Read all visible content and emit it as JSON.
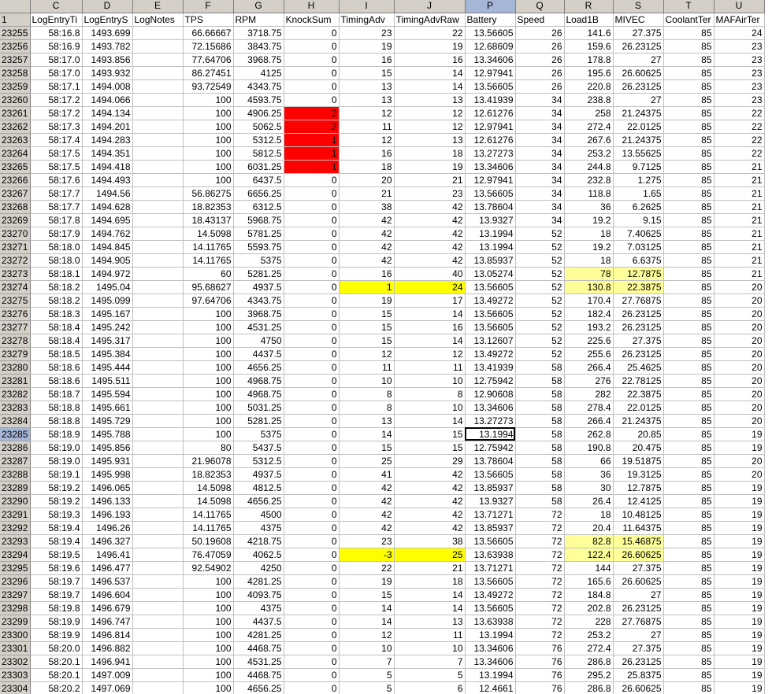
{
  "columns": [
    "C",
    "D",
    "E",
    "F",
    "G",
    "H",
    "I",
    "J",
    "P",
    "Q",
    "R",
    "S",
    "T",
    "U"
  ],
  "selected_column": "P",
  "header_row": {
    "row_label": "1",
    "cells": [
      "LogEntryTi",
      "LogEntryS",
      "LogNotes",
      "TPS",
      "RPM",
      "KnockSum",
      "TimingAdv",
      "TimingAdvRaw",
      "Battery",
      "Speed",
      "Load1B",
      "MIVEC",
      "CoolantTer",
      "MAFAirTer"
    ]
  },
  "selected_row": "23285",
  "active_cell": {
    "row": "23285",
    "col_index": 8
  },
  "rows": [
    {
      "r": "23255",
      "c": [
        "58:16.8",
        "1493.699",
        "",
        "66.66667",
        "3718.75",
        "0",
        "23",
        "22",
        "13.56605",
        "26",
        "141.6",
        "27.375",
        "85",
        "24"
      ]
    },
    {
      "r": "23256",
      "c": [
        "58:16.9",
        "1493.782",
        "",
        "72.15686",
        "3843.75",
        "0",
        "19",
        "19",
        "12.68609",
        "26",
        "159.6",
        "26.23125",
        "85",
        "23"
      ]
    },
    {
      "r": "23257",
      "c": [
        "58:17.0",
        "1493.856",
        "",
        "77.64706",
        "3968.75",
        "0",
        "16",
        "16",
        "13.34606",
        "26",
        "178.8",
        "27",
        "85",
        "23"
      ]
    },
    {
      "r": "23258",
      "c": [
        "58:17.0",
        "1493.932",
        "",
        "86.27451",
        "4125",
        "0",
        "15",
        "14",
        "12.97941",
        "26",
        "195.6",
        "26.60625",
        "85",
        "23"
      ]
    },
    {
      "r": "23259",
      "c": [
        "58:17.1",
        "1494.008",
        "",
        "93.72549",
        "4343.75",
        "0",
        "13",
        "14",
        "13.56605",
        "26",
        "220.8",
        "26.23125",
        "85",
        "23"
      ]
    },
    {
      "r": "23260",
      "c": [
        "58:17.2",
        "1494.066",
        "",
        "100",
        "4593.75",
        "0",
        "13",
        "13",
        "13.41939",
        "34",
        "238.8",
        "27",
        "85",
        "23"
      ]
    },
    {
      "r": "23261",
      "c": [
        "58:17.2",
        "1494.134",
        "",
        "100",
        "4906.25",
        "2",
        "12",
        "12",
        "12.61276",
        "34",
        "258",
        "21.24375",
        "85",
        "22"
      ]
    },
    {
      "r": "23262",
      "c": [
        "58:17.3",
        "1494.201",
        "",
        "100",
        "5062.5",
        "2",
        "11",
        "12",
        "12.97941",
        "34",
        "272.4",
        "22.0125",
        "85",
        "22"
      ]
    },
    {
      "r": "23263",
      "c": [
        "58:17.4",
        "1494.283",
        "",
        "100",
        "5312.5",
        "1",
        "12",
        "13",
        "12.61276",
        "34",
        "267.6",
        "21.24375",
        "85",
        "22"
      ]
    },
    {
      "r": "23264",
      "c": [
        "58:17.5",
        "1494.351",
        "",
        "100",
        "5812.5",
        "1",
        "16",
        "18",
        "13.27273",
        "34",
        "253.2",
        "13.55625",
        "85",
        "22"
      ]
    },
    {
      "r": "23265",
      "c": [
        "58:17.5",
        "1494.418",
        "",
        "100",
        "6031.25",
        "1",
        "18",
        "19",
        "13.34606",
        "34",
        "244.8",
        "9.7125",
        "85",
        "21"
      ]
    },
    {
      "r": "23266",
      "c": [
        "58:17.6",
        "1494.493",
        "",
        "100",
        "6437.5",
        "0",
        "20",
        "21",
        "12.97941",
        "34",
        "232.8",
        "1.275",
        "85",
        "21"
      ]
    },
    {
      "r": "23267",
      "c": [
        "58:17.7",
        "1494.56",
        "",
        "56.86275",
        "6656.25",
        "0",
        "21",
        "23",
        "13.56605",
        "34",
        "118.8",
        "1.65",
        "85",
        "21"
      ]
    },
    {
      "r": "23268",
      "c": [
        "58:17.7",
        "1494.628",
        "",
        "18.82353",
        "6312.5",
        "0",
        "38",
        "42",
        "13.78604",
        "34",
        "36",
        "6.2625",
        "85",
        "21"
      ]
    },
    {
      "r": "23269",
      "c": [
        "58:17.8",
        "1494.695",
        "",
        "18.43137",
        "5968.75",
        "0",
        "42",
        "42",
        "13.9327",
        "34",
        "19.2",
        "9.15",
        "85",
        "21"
      ]
    },
    {
      "r": "23270",
      "c": [
        "58:17.9",
        "1494.762",
        "",
        "14.5098",
        "5781.25",
        "0",
        "42",
        "42",
        "13.1994",
        "52",
        "18",
        "7.40625",
        "85",
        "21"
      ]
    },
    {
      "r": "23271",
      "c": [
        "58:18.0",
        "1494.845",
        "",
        "14.11765",
        "5593.75",
        "0",
        "42",
        "42",
        "13.1994",
        "52",
        "19.2",
        "7.03125",
        "85",
        "21"
      ]
    },
    {
      "r": "23272",
      "c": [
        "58:18.0",
        "1494.905",
        "",
        "14.11765",
        "5375",
        "0",
        "42",
        "42",
        "13.85937",
        "52",
        "18",
        "6.6375",
        "85",
        "21"
      ]
    },
    {
      "r": "23273",
      "c": [
        "58:18.1",
        "1494.972",
        "",
        "60",
        "5281.25",
        "0",
        "16",
        "40",
        "13.05274",
        "52",
        "78",
        "12.7875",
        "85",
        "21"
      ]
    },
    {
      "r": "23274",
      "c": [
        "58:18.2",
        "1495.04",
        "",
        "95.68627",
        "4937.5",
        "0",
        "1",
        "24",
        "13.56605",
        "52",
        "130.8",
        "22.3875",
        "85",
        "20"
      ]
    },
    {
      "r": "23275",
      "c": [
        "58:18.2",
        "1495.099",
        "",
        "97.64706",
        "4343.75",
        "0",
        "19",
        "17",
        "13.49272",
        "52",
        "170.4",
        "27.76875",
        "85",
        "20"
      ]
    },
    {
      "r": "23276",
      "c": [
        "58:18.3",
        "1495.167",
        "",
        "100",
        "3968.75",
        "0",
        "15",
        "14",
        "13.56605",
        "52",
        "182.4",
        "26.23125",
        "85",
        "20"
      ]
    },
    {
      "r": "23277",
      "c": [
        "58:18.4",
        "1495.242",
        "",
        "100",
        "4531.25",
        "0",
        "15",
        "16",
        "13.56605",
        "52",
        "193.2",
        "26.23125",
        "85",
        "20"
      ]
    },
    {
      "r": "23278",
      "c": [
        "58:18.4",
        "1495.317",
        "",
        "100",
        "4750",
        "0",
        "15",
        "14",
        "13.12607",
        "52",
        "225.6",
        "27.375",
        "85",
        "20"
      ]
    },
    {
      "r": "23279",
      "c": [
        "58:18.5",
        "1495.384",
        "",
        "100",
        "4437.5",
        "0",
        "12",
        "12",
        "13.49272",
        "52",
        "255.6",
        "26.23125",
        "85",
        "20"
      ]
    },
    {
      "r": "23280",
      "c": [
        "58:18.6",
        "1495.444",
        "",
        "100",
        "4656.25",
        "0",
        "11",
        "11",
        "13.41939",
        "58",
        "266.4",
        "25.4625",
        "85",
        "20"
      ]
    },
    {
      "r": "23281",
      "c": [
        "58:18.6",
        "1495.511",
        "",
        "100",
        "4968.75",
        "0",
        "10",
        "10",
        "12.75942",
        "58",
        "276",
        "22.78125",
        "85",
        "20"
      ]
    },
    {
      "r": "23282",
      "c": [
        "58:18.7",
        "1495.594",
        "",
        "100",
        "4968.75",
        "0",
        "8",
        "8",
        "12.90608",
        "58",
        "282",
        "22.3875",
        "85",
        "20"
      ]
    },
    {
      "r": "23283",
      "c": [
        "58:18.8",
        "1495.661",
        "",
        "100",
        "5031.25",
        "0",
        "8",
        "10",
        "13.34606",
        "58",
        "278.4",
        "22.0125",
        "85",
        "20"
      ]
    },
    {
      "r": "23284",
      "c": [
        "58:18.8",
        "1495.729",
        "",
        "100",
        "5281.25",
        "0",
        "13",
        "14",
        "13.27273",
        "58",
        "266.4",
        "21.24375",
        "85",
        "20"
      ]
    },
    {
      "r": "23285",
      "c": [
        "58:18.9",
        "1495.788",
        "",
        "100",
        "5375",
        "0",
        "14",
        "15",
        "13.1994",
        "58",
        "262.8",
        "20.85",
        "85",
        "19"
      ]
    },
    {
      "r": "23286",
      "c": [
        "58:19.0",
        "1495.856",
        "",
        "80",
        "5437.5",
        "0",
        "15",
        "15",
        "12.75942",
        "58",
        "190.8",
        "20.475",
        "85",
        "19"
      ]
    },
    {
      "r": "23287",
      "c": [
        "58:19.0",
        "1495.931",
        "",
        "21.96078",
        "5312.5",
        "0",
        "25",
        "29",
        "13.78604",
        "58",
        "66",
        "19.51875",
        "85",
        "20"
      ]
    },
    {
      "r": "23288",
      "c": [
        "58:19.1",
        "1495.998",
        "",
        "18.82353",
        "4937.5",
        "0",
        "41",
        "42",
        "13.56605",
        "58",
        "36",
        "19.3125",
        "85",
        "20"
      ]
    },
    {
      "r": "23289",
      "c": [
        "58:19.2",
        "1496.065",
        "",
        "14.5098",
        "4812.5",
        "0",
        "42",
        "42",
        "13.85937",
        "58",
        "30",
        "12.7875",
        "85",
        "19"
      ]
    },
    {
      "r": "23290",
      "c": [
        "58:19.2",
        "1496.133",
        "",
        "14.5098",
        "4656.25",
        "0",
        "42",
        "42",
        "13.9327",
        "58",
        "26.4",
        "12.4125",
        "85",
        "19"
      ]
    },
    {
      "r": "23291",
      "c": [
        "58:19.3",
        "1496.193",
        "",
        "14.11765",
        "4500",
        "0",
        "42",
        "42",
        "13.71271",
        "72",
        "18",
        "10.48125",
        "85",
        "19"
      ]
    },
    {
      "r": "23292",
      "c": [
        "58:19.4",
        "1496.26",
        "",
        "14.11765",
        "4375",
        "0",
        "42",
        "42",
        "13.85937",
        "72",
        "20.4",
        "11.64375",
        "85",
        "19"
      ]
    },
    {
      "r": "23293",
      "c": [
        "58:19.4",
        "1496.327",
        "",
        "50.19608",
        "4218.75",
        "0",
        "23",
        "38",
        "13.56605",
        "72",
        "82.8",
        "15.46875",
        "85",
        "19"
      ]
    },
    {
      "r": "23294",
      "c": [
        "58:19.5",
        "1496.41",
        "",
        "76.47059",
        "4062.5",
        "0",
        "-3",
        "25",
        "13.63938",
        "72",
        "122.4",
        "26.60625",
        "85",
        "19"
      ]
    },
    {
      "r": "23295",
      "c": [
        "58:19.6",
        "1496.477",
        "",
        "92.54902",
        "4250",
        "0",
        "22",
        "21",
        "13.71271",
        "72",
        "144",
        "27.375",
        "85",
        "19"
      ]
    },
    {
      "r": "23296",
      "c": [
        "58:19.7",
        "1496.537",
        "",
        "100",
        "4281.25",
        "0",
        "19",
        "18",
        "13.56605",
        "72",
        "165.6",
        "26.60625",
        "85",
        "19"
      ]
    },
    {
      "r": "23297",
      "c": [
        "58:19.7",
        "1496.604",
        "",
        "100",
        "4093.75",
        "0",
        "15",
        "14",
        "13.49272",
        "72",
        "184.8",
        "27",
        "85",
        "19"
      ]
    },
    {
      "r": "23298",
      "c": [
        "58:19.8",
        "1496.679",
        "",
        "100",
        "4375",
        "0",
        "14",
        "14",
        "13.56605",
        "72",
        "202.8",
        "26.23125",
        "85",
        "19"
      ]
    },
    {
      "r": "23299",
      "c": [
        "58:19.9",
        "1496.747",
        "",
        "100",
        "4437.5",
        "0",
        "14",
        "13",
        "13.63938",
        "72",
        "228",
        "27.76875",
        "85",
        "19"
      ]
    },
    {
      "r": "23300",
      "c": [
        "58:19.9",
        "1496.814",
        "",
        "100",
        "4281.25",
        "0",
        "12",
        "11",
        "13.1994",
        "72",
        "253.2",
        "27",
        "85",
        "19"
      ]
    },
    {
      "r": "23301",
      "c": [
        "58:20.0",
        "1496.882",
        "",
        "100",
        "4468.75",
        "0",
        "10",
        "10",
        "13.34606",
        "76",
        "272.4",
        "27.375",
        "85",
        "19"
      ]
    },
    {
      "r": "23302",
      "c": [
        "58:20.1",
        "1496.941",
        "",
        "100",
        "4531.25",
        "0",
        "7",
        "7",
        "13.34606",
        "76",
        "286.8",
        "26.23125",
        "85",
        "19"
      ]
    },
    {
      "r": "23303",
      "c": [
        "58:20.1",
        "1497.009",
        "",
        "100",
        "4468.75",
        "0",
        "5",
        "5",
        "13.1994",
        "76",
        "295.2",
        "25.8375",
        "85",
        "19"
      ]
    },
    {
      "r": "23304",
      "c": [
        "58:20.2",
        "1497.069",
        "",
        "100",
        "4656.25",
        "0",
        "5",
        "6",
        "12.4661",
        "76",
        "286.8",
        "26.60625",
        "85",
        "19"
      ]
    }
  ],
  "highlights": {
    "red": "#ff0000",
    "yellow": "#ffff00",
    "pale_yellow": "#ffff99",
    "red_cells": [
      [
        "23261",
        5
      ],
      [
        "23262",
        5
      ],
      [
        "23263",
        5
      ],
      [
        "23264",
        5
      ],
      [
        "23265",
        5
      ]
    ],
    "yellow_cells": [
      [
        "23274",
        6
      ],
      [
        "23274",
        7
      ],
      [
        "23294",
        6
      ],
      [
        "23294",
        7
      ]
    ],
    "pale_yellow_cells": [
      [
        "23273",
        10
      ],
      [
        "23273",
        11
      ],
      [
        "23274",
        10
      ],
      [
        "23274",
        11
      ],
      [
        "23293",
        10
      ],
      [
        "23293",
        11
      ],
      [
        "23294",
        10
      ],
      [
        "23294",
        11
      ]
    ]
  }
}
